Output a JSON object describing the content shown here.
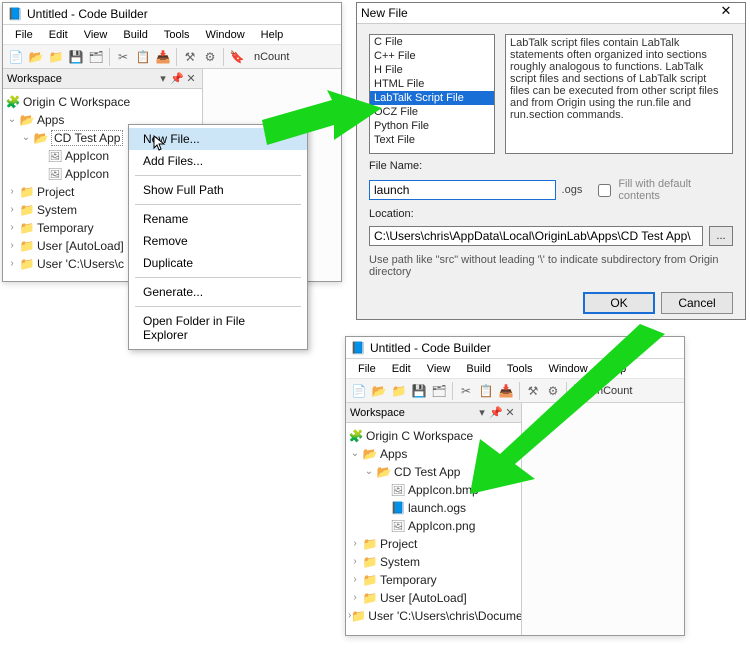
{
  "window1": {
    "title": "Untitled - Code Builder",
    "menus": [
      "File",
      "Edit",
      "View",
      "Build",
      "Tools",
      "Window",
      "Help"
    ],
    "toolbar_label": "nCount",
    "ws_label": "Workspace",
    "tree": {
      "root": "Origin C Workspace",
      "apps": "Apps",
      "cdtest": "CD Test App",
      "file1": "AppIcon",
      "file2": "AppIcon",
      "project": "Project",
      "system": "System",
      "temporary": "Temporary",
      "userauto": "User  [AutoLoad]",
      "userpath": "User 'C:\\Users\\c"
    }
  },
  "context": {
    "new_file": "New File...",
    "add_files": "Add Files...",
    "show_full_path": "Show Full Path",
    "rename": "Rename",
    "remove": "Remove",
    "duplicate": "Duplicate",
    "generate": "Generate...",
    "open_folder": "Open Folder in File Explorer"
  },
  "dialog": {
    "title": "New File",
    "types": [
      "C File",
      "C++ File",
      "H File",
      "HTML File",
      "LabTalk Script File",
      "OCZ File",
      "Python File",
      "Text File"
    ],
    "selected_index": 4,
    "desc": "LabTalk script files contain LabTalk statements often organized into sections roughly analogous to functions. LabTalk script files and sections of LabTalk script files can be executed from other script files and from Origin using the run.file and run.section commands.",
    "filename_label": "File Name:",
    "filename_value": "launch",
    "ext": ".ogs",
    "fill_label": "Fill with default contents",
    "location_label": "Location:",
    "location_value": "C:\\Users\\chris\\AppData\\Local\\OriginLab\\Apps\\CD Test App\\",
    "hint": "Use path like \"src\" without leading '\\' to indicate subdirectory from Origin directory",
    "ok": "OK",
    "cancel": "Cancel",
    "browse": "..."
  },
  "window2": {
    "title": "Untitled - Code Builder",
    "menus": [
      "File",
      "Edit",
      "View",
      "Build",
      "Tools",
      "Window",
      "Help"
    ],
    "toolbar_label": "nCount",
    "ws_label": "Workspace",
    "tree": {
      "root": "Origin C Workspace",
      "apps": "Apps",
      "cdtest": "CD Test App",
      "bmp": "AppIcon.bmp",
      "ogs": "launch.ogs",
      "png": "AppIcon.png",
      "project": "Project",
      "system": "System",
      "temporary": "Temporary",
      "userauto": "User  [AutoLoad]",
      "userpath": "User 'C:\\Users\\chris\\Documents"
    }
  }
}
